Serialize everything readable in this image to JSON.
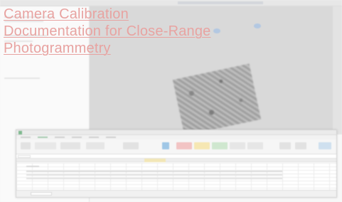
{
  "title_link": {
    "text": "Camera Calibration Documentation for Close-Range Photogrammetry"
  },
  "colors": {
    "link": "#e8a3a1",
    "viewport": "#d9d9d9",
    "spreadsheet_accent": "#7fb98f"
  },
  "icons": {
    "spreadsheet_app": "spreadsheet-app-icon",
    "camera_marker": "camera-position-marker"
  }
}
